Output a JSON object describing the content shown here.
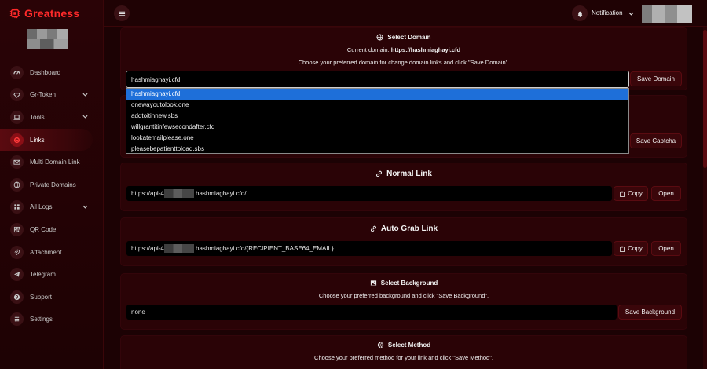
{
  "app": {
    "brand": "Greatness",
    "brand_color": "#ff2a2a",
    "accent": "#8a0f16"
  },
  "sidebar": {
    "items": [
      {
        "label": "Dashboard",
        "icon": "gauge-icon",
        "has_chevron": false
      },
      {
        "label": "Gr-Token",
        "icon": "gem-icon",
        "has_chevron": true
      },
      {
        "label": "Tools",
        "icon": "laptop-icon",
        "has_chevron": true
      },
      {
        "label": "Links",
        "icon": "link-icon",
        "has_chevron": false,
        "active": true
      },
      {
        "label": "Multi Domain Link",
        "icon": "envelope-icon",
        "has_chevron": false
      },
      {
        "label": "Private Domains",
        "icon": "globe-icon",
        "has_chevron": false
      },
      {
        "label": "All Logs",
        "icon": "grid-icon",
        "has_chevron": true
      },
      {
        "label": "QR Code",
        "icon": "qrcode-icon",
        "has_chevron": false
      },
      {
        "label": "Attachment",
        "icon": "paperclip-icon",
        "has_chevron": false
      },
      {
        "label": "Telegram",
        "icon": "telegram-icon",
        "has_chevron": false
      },
      {
        "label": "Support",
        "icon": "question-icon",
        "has_chevron": false
      },
      {
        "label": "Settings",
        "icon": "settings-icon",
        "has_chevron": false
      }
    ]
  },
  "topbar": {
    "notification_label": "Notification"
  },
  "domain": {
    "title": "Select Domain",
    "current_prefix": "Current domain:",
    "current_value": "https://hashmiaghayi.cfd",
    "instruction": "Choose your preferred domain for change domain links and click \"Save Domain\".",
    "selected": "hashmiaghayi.cfd",
    "options": [
      "hashmiaghayi.cfd",
      "onewayoutolook.one",
      "addtoitinnew.sbs",
      "willgrantitinfewsecondafter.cfd",
      "lookatemailplease.one",
      "pleasebepatienttoload.sbs"
    ],
    "save_label": "Save Domain"
  },
  "captcha": {
    "save_label": "Save Captcha"
  },
  "normal_link": {
    "title": "Normal Link",
    "url_prefix": "https://api-4",
    "url_suffix": ".hashmiaghayi.cfd/",
    "copy_label": "Copy",
    "open_label": "Open"
  },
  "auto_grab": {
    "title": "Auto Grab Link",
    "url_prefix": "https://api-4",
    "url_suffix": ".hashmiaghayi.cfd/{RECIPIENT_BASE64_EMAIL}",
    "copy_label": "Copy",
    "open_label": "Open"
  },
  "background": {
    "title": "Select Background",
    "instruction": "Choose your preferred background and click \"Save Background\".",
    "value": "none",
    "save_label": "Save Background"
  },
  "method": {
    "title": "Select Method",
    "instruction": "Choose your preferred method for your link and click \"Save Method\"."
  }
}
